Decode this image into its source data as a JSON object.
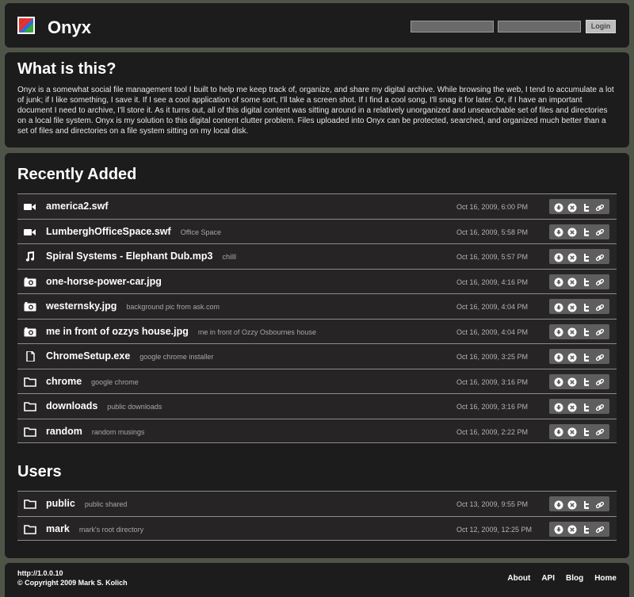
{
  "header": {
    "brand": "Onyx",
    "login": {
      "username_value": "",
      "password_value": "",
      "button_label": "Login"
    }
  },
  "about": {
    "title": "What is this?",
    "text": "Onyx is a somewhat social file management tool I built to help me keep track of, organize, and share my digital archive. While browsing the web, I tend to accumulate a lot of junk; if I like something, I save it. If I see a cool application of some sort, I'll take a screen shot. If I find a cool song, I'll snag it for later. Or, if I have an important document I need to archive, I'll store it. As it turns out, all of this digital content was sitting around in a relatively unorganized and unsearchable set of files and directories on a local file system. Onyx is my solution to this digital content clutter problem. Files uploaded into Onyx can be protected, searched, and organized much better than a set of files and directories on a file system sitting on my local disk."
  },
  "recent": {
    "title": "Recently Added",
    "items": [
      {
        "icon": "video-icon",
        "name": "america2.swf",
        "desc": "",
        "date": "Oct 16, 2009, 6:00 PM"
      },
      {
        "icon": "video-icon",
        "name": "LumberghOfficeSpace.swf",
        "desc": "Office Space",
        "date": "Oct 16, 2009, 5:58 PM"
      },
      {
        "icon": "music-icon",
        "name": "Spiral Systems - Elephant Dub.mp3",
        "desc": "chilll",
        "date": "Oct 16, 2009, 5:57 PM"
      },
      {
        "icon": "camera-icon",
        "name": "one-horse-power-car.jpg",
        "desc": "",
        "date": "Oct 16, 2009, 4:16 PM"
      },
      {
        "icon": "camera-icon",
        "name": "westernsky.jpg",
        "desc": "background pic from ask.com",
        "date": "Oct 16, 2009, 4:04 PM"
      },
      {
        "icon": "camera-icon",
        "name": "me in front of ozzys house.jpg",
        "desc": "me in front of Ozzy Osbournes house",
        "date": "Oct 16, 2009, 4:04 PM"
      },
      {
        "icon": "file-icon",
        "name": "ChromeSetup.exe",
        "desc": "google chrome installer",
        "date": "Oct 16, 2009, 3:25 PM"
      },
      {
        "icon": "folder-icon",
        "name": "chrome",
        "desc": "google chrome",
        "date": "Oct 16, 2009, 3:16 PM"
      },
      {
        "icon": "folder-icon",
        "name": "downloads",
        "desc": "public downloads",
        "date": "Oct 16, 2009, 3:16 PM"
      },
      {
        "icon": "folder-icon",
        "name": "random",
        "desc": "random musings",
        "date": "Oct 16, 2009, 2:22 PM"
      }
    ]
  },
  "users": {
    "title": "Users",
    "items": [
      {
        "icon": "folder-icon",
        "name": "public",
        "desc": "public shared",
        "date": "Oct 13, 2009, 9:55 PM"
      },
      {
        "icon": "folder-icon",
        "name": "mark",
        "desc": "mark's root directory",
        "date": "Oct 12, 2009, 12:25 PM"
      }
    ]
  },
  "row_actions": [
    "download-icon",
    "delete-icon",
    "twitter-icon",
    "link-icon"
  ],
  "footer": {
    "host": "http://1.0.0.10",
    "copyright": "© Copyright 2009 Mark S. Kolich",
    "links": [
      "About",
      "API",
      "Blog",
      "Home"
    ]
  },
  "colors": {
    "background": "#4f5449",
    "panel": "#1c1c1c",
    "row": "#262424",
    "action_bar": "#5e5e5e"
  }
}
